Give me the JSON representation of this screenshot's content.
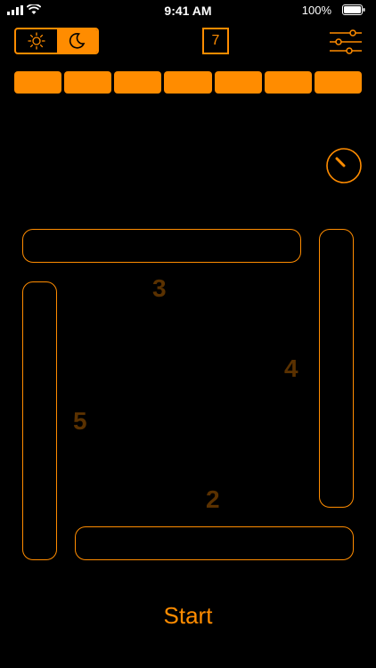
{
  "status_bar": {
    "time": "9:41 AM",
    "battery": "100%"
  },
  "header": {
    "level": "7"
  },
  "progress": {
    "segments": 7
  },
  "board": {
    "labels": {
      "top": "3",
      "right": "4",
      "bottom": "2",
      "left": "5"
    }
  },
  "actions": {
    "start_label": "Start"
  },
  "colors": {
    "accent": "#FF8C00",
    "dim_label": "#5A3100",
    "background": "#000000"
  },
  "icons": [
    "signal-icon",
    "wifi-icon",
    "battery-icon",
    "sun-icon",
    "moon-icon",
    "level-frame-icon",
    "sliders-icon",
    "timer-icon"
  ]
}
